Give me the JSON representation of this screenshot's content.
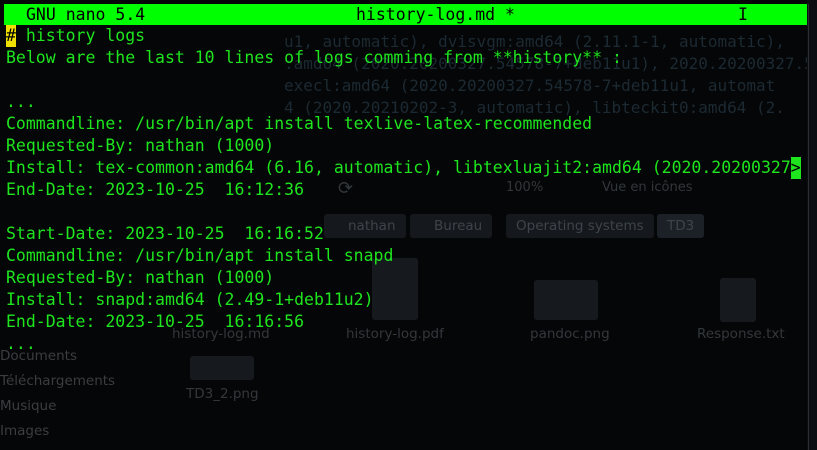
{
  "titlebar": {
    "app": "GNU nano 5.4",
    "filename": "history-log.md *",
    "indicator": "I"
  },
  "editor": {
    "cursor_char": "#",
    "lines": [
      " history logs",
      "Below are the last 10 lines of logs comming from **history** :",
      "",
      "...",
      "Commandline: /usr/bin/apt install texlive-latex-recommended",
      "Requested-By: nathan (1000)",
      "Install: tex-common:amd64 (6.16, automatic), libtexluajit2:amd64 (2020.20200327",
      "End-Date: 2023-10-25  16:12:36",
      "",
      "Start-Date: 2023-10-25  16:16:52",
      "Commandline: /usr/bin/apt install snapd",
      "Requested-By: nathan (1000)",
      "Install: snapd:amd64 (2.49-1+deb11u2)",
      "End-Date: 2023-10-25  16:16:56",
      "..."
    ],
    "overflow_marker": ">"
  },
  "background_window": {
    "terminal_lines": [
      "u1, automatic), dvisvgm:amd64 (2.11.1-1, automatic),",
      ":amd64 (2020.20200327.54578-7+deb11u1), 2020.20200327.54578-",
      "execl:amd64 (2020.20200327.54578-7+deb11u1, automat",
      "4 (2020.20210202-3, automatic), libteckit0:amd64 (2."
    ],
    "zoom": "100%",
    "view_mode": "Vue en icônes",
    "breadcrumb": [
      "nathan",
      "Bureau",
      "Operating systems",
      "TD3"
    ],
    "sidebar": [
      "Documents",
      "Téléchargements",
      "Musique",
      "Images"
    ],
    "files": [
      "history-log.md",
      "history-log.pdf",
      "pandoc.png",
      "Response.txt",
      "TD3_2.png"
    ]
  },
  "colors": {
    "titlebar_bg": "#00ff00",
    "text": "#1ee51e",
    "cursor": "#f0e000",
    "background": "#050607"
  }
}
